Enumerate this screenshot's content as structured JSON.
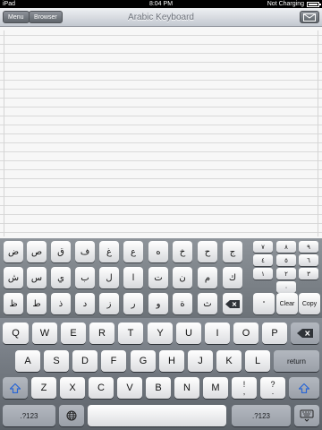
{
  "status": {
    "device": "iPad",
    "time": "8:04 PM",
    "charging": "Not Charging"
  },
  "nav": {
    "menu_label": "Menu",
    "browser_label": "Browser",
    "title": "Arabic Keyboard",
    "mail_icon": "envelope-icon"
  },
  "editor": {
    "text": ""
  },
  "arabic": {
    "row1": [
      "ض",
      "ص",
      "ق",
      "ف",
      "غ",
      "ع",
      "ه",
      "خ",
      "ح",
      "ج"
    ],
    "row2": [
      "ش",
      "س",
      "ي",
      "ب",
      "ل",
      "ا",
      "ت",
      "ن",
      "م",
      "ك"
    ],
    "row3": [
      "ظ",
      "ط",
      "ذ",
      "د",
      "ز",
      "ر",
      "و",
      "ة",
      "ث"
    ],
    "numpad": [
      "٧",
      "٨",
      "٩",
      "٤",
      "٥",
      "٦",
      "١",
      "٢",
      "٣",
      "٠"
    ],
    "dot": "°",
    "clear_label": "Clear",
    "copy_label": "Copy"
  },
  "keyboard": {
    "row1": [
      "Q",
      "W",
      "E",
      "R",
      "T",
      "Y",
      "U",
      "I",
      "O",
      "P"
    ],
    "row2": [
      "A",
      "S",
      "D",
      "F",
      "G",
      "H",
      "J",
      "K",
      "L"
    ],
    "row3": [
      "Z",
      "X",
      "C",
      "V",
      "B",
      "N",
      "M"
    ],
    "return_label": "return",
    "excl": [
      "!",
      ","
    ],
    "quest": [
      "?",
      "."
    ],
    "numbers_label": ".?123"
  }
}
